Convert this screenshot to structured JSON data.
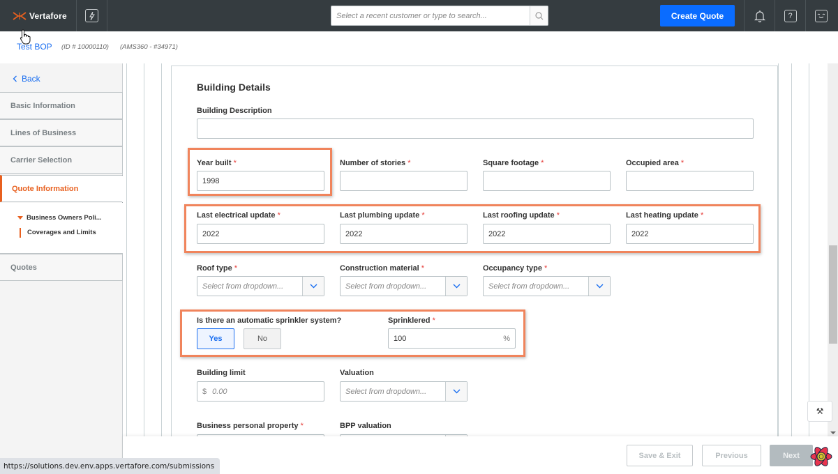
{
  "topbar": {
    "brand": "Vertafore",
    "search_placeholder": "Select a recent customer or type to search...",
    "create_quote_label": "Create Quote",
    "help_glyph": "?",
    "icons": [
      "vertafore-logo-icon",
      "lightning-icon",
      "search-icon",
      "bell-icon",
      "help-icon",
      "smiley-icon"
    ]
  },
  "subheader": {
    "title": "Test BOP",
    "id_text": "(ID # 10000110)",
    "ams_text": "(AMS360 - #34971)"
  },
  "sidebar": {
    "back_label": "Back",
    "items": [
      {
        "label": "Basic Information",
        "active": false
      },
      {
        "label": "Lines of Business",
        "active": false
      },
      {
        "label": "Carrier Selection",
        "active": false
      },
      {
        "label": "Quote Information",
        "active": true
      },
      {
        "label": "Quotes",
        "active": false
      }
    ],
    "subitems": [
      {
        "label": "Business Owners Poli..."
      },
      {
        "label": "Coverages and Limits"
      }
    ]
  },
  "form": {
    "section_title": "Building Details",
    "building_description": {
      "label": "Building Description",
      "value": ""
    },
    "year_built": {
      "label": "Year built",
      "required": "*",
      "value": "1998"
    },
    "number_of_stories": {
      "label": "Number of stories",
      "required": "*",
      "value": ""
    },
    "square_footage": {
      "label": "Square footage",
      "required": "*",
      "value": ""
    },
    "occupied_area": {
      "label": "Occupied area",
      "required": "*",
      "value": ""
    },
    "last_electrical_update": {
      "label": "Last electrical update",
      "required": "*",
      "value": "2022"
    },
    "last_plumbing_update": {
      "label": "Last plumbing update",
      "required": "*",
      "value": "2022"
    },
    "last_roofing_update": {
      "label": "Last roofing update",
      "required": "*",
      "value": "2022"
    },
    "last_heating_update": {
      "label": "Last heating update",
      "required": "*",
      "value": "2022"
    },
    "roof_type": {
      "label": "Roof type",
      "required": "*",
      "placeholder": "Select from dropdown..."
    },
    "construction_material": {
      "label": "Construction material",
      "required": "*",
      "placeholder": "Select from dropdown..."
    },
    "occupancy_type": {
      "label": "Occupancy type",
      "required": "*",
      "placeholder": "Select from dropdown..."
    },
    "sprinkler_question": {
      "label": "Is there an automatic sprinkler system?",
      "yes_label": "Yes",
      "no_label": "No",
      "selected": "Yes"
    },
    "sprinklered": {
      "label": "Sprinklered",
      "required": "*",
      "value": "100",
      "unit": "%"
    },
    "building_limit": {
      "label": "Building limit",
      "currency": "$",
      "placeholder": "0.00"
    },
    "valuation": {
      "label": "Valuation",
      "placeholder": "Select from dropdown..."
    },
    "business_personal_property": {
      "label": "Business personal property",
      "required": "*"
    },
    "bpp_valuation": {
      "label": "BPP valuation"
    }
  },
  "footer": {
    "save_exit_label": "Save & Exit",
    "previous_label": "Previous",
    "next_label": "Next"
  },
  "tools_glyph": "⚒",
  "status_url": "https://solutions.dev.env.apps.vertafore.com/submissions",
  "colors": {
    "topbar_bg": "#353c40",
    "primary_blue": "#0a6cff",
    "accent_orange": "#e8601f",
    "highlight_orange": "#f0845c",
    "required_red": "#e53935"
  }
}
